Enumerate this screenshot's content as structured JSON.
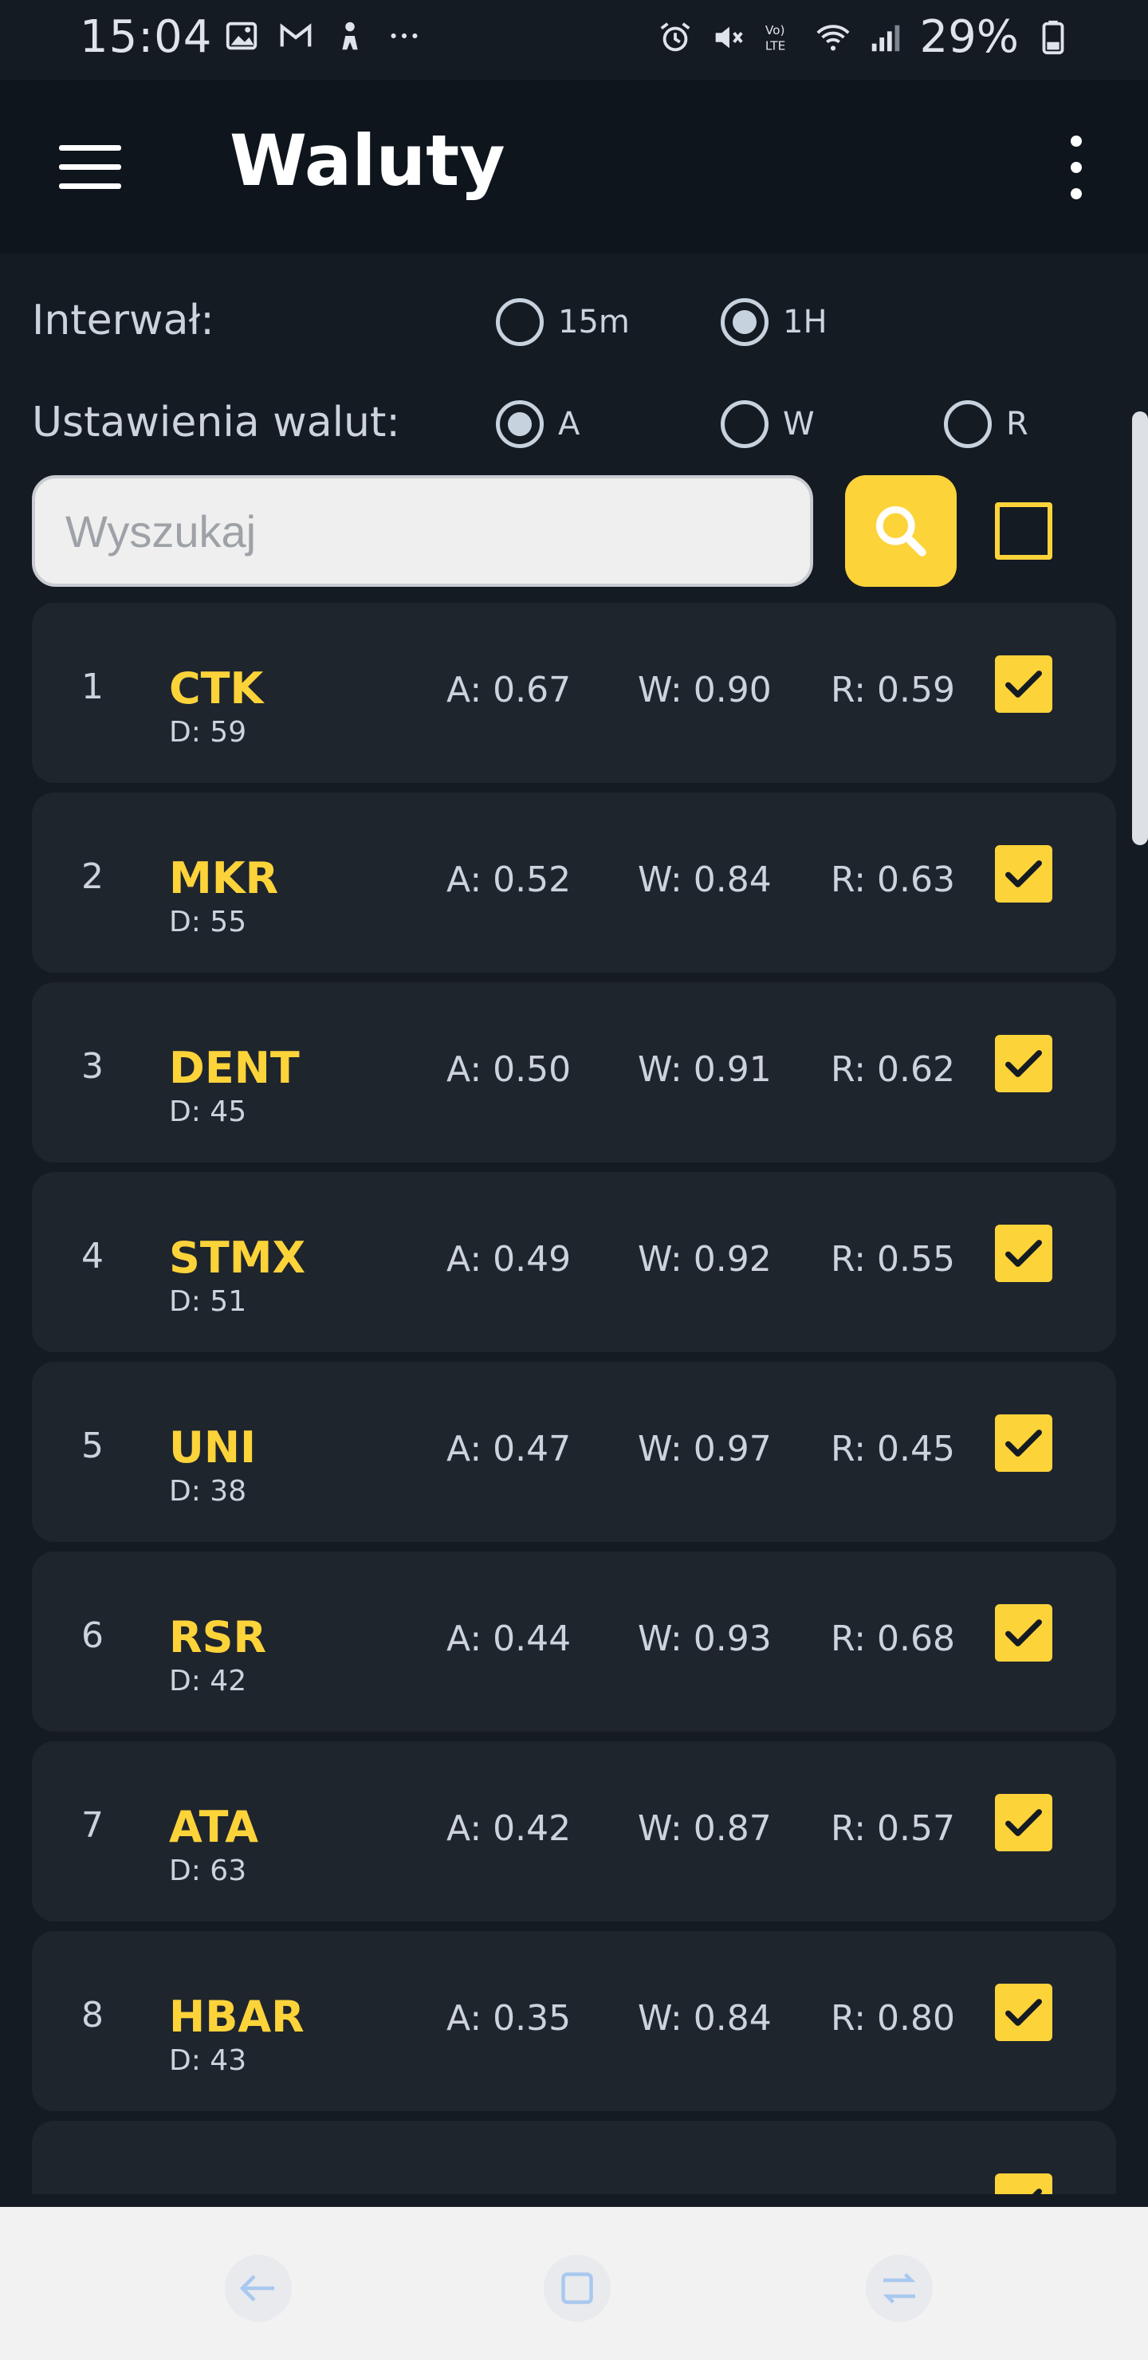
{
  "status_bar": {
    "time": "15:04",
    "battery": "29%",
    "icons_left": [
      "image-icon",
      "gmail-icon",
      "person-icon",
      "more-notifications-icon"
    ],
    "icons_right": [
      "alarm-icon",
      "mute-icon",
      "volte-icon",
      "wifi-icon",
      "signal-icon",
      "battery-icon"
    ]
  },
  "app_bar": {
    "title": "Waluty"
  },
  "interval": {
    "label": "Interwał:",
    "options": [
      "15m",
      "1H"
    ],
    "selected": "1H"
  },
  "currency_settings": {
    "label": "Ustawienia walut:",
    "options": [
      "A",
      "W",
      "R"
    ],
    "selected": "A"
  },
  "search": {
    "placeholder": "Wyszukaj",
    "value": ""
  },
  "select_all_checked": false,
  "colors": {
    "accent": "#fdd33a",
    "background": "#151b22",
    "card": "#1f252d",
    "appbar": "#0f151c"
  },
  "currencies": [
    {
      "index": "1",
      "symbol": "CTK",
      "d": "D: 59",
      "a": "A: 0.67",
      "w": "W: 0.90",
      "r": "R: 0.59",
      "checked": true
    },
    {
      "index": "2",
      "symbol": "MKR",
      "d": "D: 55",
      "a": "A: 0.52",
      "w": "W: 0.84",
      "r": "R: 0.63",
      "checked": true
    },
    {
      "index": "3",
      "symbol": "DENT",
      "d": "D: 45",
      "a": "A: 0.50",
      "w": "W: 0.91",
      "r": "R: 0.62",
      "checked": true
    },
    {
      "index": "4",
      "symbol": "STMX",
      "d": "D: 51",
      "a": "A: 0.49",
      "w": "W: 0.92",
      "r": "R: 0.55",
      "checked": true
    },
    {
      "index": "5",
      "symbol": "UNI",
      "d": "D: 38",
      "a": "A: 0.47",
      "w": "W: 0.97",
      "r": "R: 0.45",
      "checked": true
    },
    {
      "index": "6",
      "symbol": "RSR",
      "d": "D: 42",
      "a": "A: 0.44",
      "w": "W: 0.93",
      "r": "R: 0.68",
      "checked": true
    },
    {
      "index": "7",
      "symbol": "ATA",
      "d": "D: 63",
      "a": "A: 0.42",
      "w": "W: 0.87",
      "r": "R: 0.57",
      "checked": true
    },
    {
      "index": "8",
      "symbol": "HBAR",
      "d": "D: 43",
      "a": "A: 0.35",
      "w": "W: 0.84",
      "r": "R: 0.80",
      "checked": true
    },
    {
      "index": "",
      "symbol": "",
      "d": "",
      "a": "",
      "w": "",
      "r": "",
      "checked": true
    }
  ],
  "nav_bar": {
    "buttons": [
      "back-icon",
      "recents-icon",
      "switch-apps-icon"
    ]
  }
}
